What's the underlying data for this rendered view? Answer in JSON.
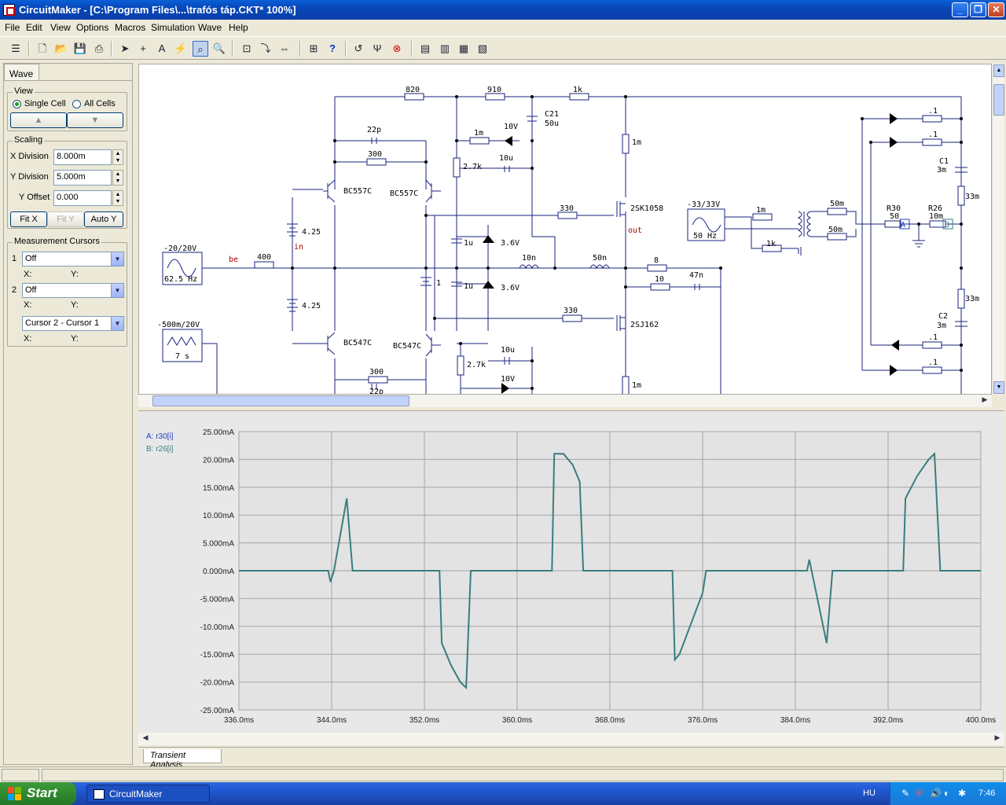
{
  "window": {
    "title": "CircuitMaker - [C:\\Program Files\\...\\trafós táp.CKT* 100%]"
  },
  "menu": [
    "File",
    "Edit",
    "View",
    "Options",
    "Macros",
    "Simulation",
    "Wave",
    "Help"
  ],
  "panel": {
    "tab": "Wave",
    "view_group": "View",
    "single_cell": "Single Cell",
    "all_cells": "All Cells",
    "up_arrow": "▲",
    "down_arrow": "▼",
    "scaling_group": "Scaling",
    "x_division_label": "X Division",
    "x_division_value": "8.000m",
    "y_division_label": "Y Division",
    "y_division_value": "5.000m",
    "y_offset_label": "Y Offset",
    "y_offset_value": "0.000",
    "fit_x": "Fit X",
    "fit_y": "Fit Y",
    "auto_y": "Auto Y",
    "measurement_group": "Measurement Cursors",
    "cursor1_num": "1",
    "cursor1_value": "Off",
    "cursor2_num": "2",
    "cursor2_value": "Off",
    "cursor_diff_value": "Cursor 2 - Cursor 1",
    "x_label": "X:",
    "y_label": "Y:"
  },
  "schematic": {
    "labels": {
      "r820": "820",
      "r910": "910",
      "r1k_top": "1k",
      "c21": "C21",
      "c21v": "50u",
      "c22p": "22p",
      "r300a": "300",
      "r1m_a": "1m",
      "z10v": "10V",
      "r2_7k": "2.7k",
      "c10u": "10u",
      "q_bc557c_1": "BC557C",
      "q_bc557c_2": "BC557C",
      "b425a": "4.25",
      "in": "in",
      "r330a": "330",
      "m2sk": "2SK1058",
      "out": "out",
      "r1m_right": "1m",
      "gen1": "-20/20V",
      "gen1f": "62.5 Hz",
      "be": "be",
      "r400": "400",
      "c1u_a": "1u",
      "z36a": "3.6V",
      "l10n": "10n",
      "l50n": "50n",
      "r8": "8",
      "b1": "1",
      "c1u_b": "1u",
      "z36b": "3.6V",
      "r10": "10",
      "c47n": "47n",
      "b425b": "4.25",
      "r330b": "330",
      "m2sj": "2SJ162",
      "gen2": "-500m/20V",
      "gen2f": "7 s",
      "q_bc547c_1": "BC547C",
      "q_bc547c_2": "BC547C",
      "r2_7k_b": "2.7k",
      "c10u_b": "10u",
      "r300b": "300",
      "c22p_b": "22p",
      "z10v_b": "10V",
      "r1m_bottom": "1m",
      "gen3": "-33/33V",
      "gen3f": "50 Hz",
      "r1m_t": "1m",
      "r50m_a": "50m",
      "r50m_b": "50m",
      "r1k_t": "1k",
      "r30": "R30",
      "r30v": "50",
      "r26": "R26",
      "r26v": "10m",
      "probe_a": "A",
      "probe_b": "B",
      "d01a": ".1",
      "d01b": ".1",
      "d01c": ".1",
      "d01d": ".1",
      "c1": "C1",
      "c1v": "3m",
      "c2": "C2",
      "c2v": "3m",
      "r33m_a": "33m",
      "r33m_b": "33m"
    }
  },
  "chart_data": {
    "type": "line",
    "series": [
      {
        "name": "A: r30[i]",
        "color": "#1f3fbf"
      },
      {
        "name": "B: r26[i]",
        "color": "#3a7d7e"
      }
    ],
    "x_ticks": [
      "336.0ms",
      "344.0ms",
      "352.0ms",
      "360.0ms",
      "368.0ms",
      "376.0ms",
      "384.0ms",
      "392.0ms",
      "400.0ms"
    ],
    "y_ticks": [
      "25.00mA",
      "20.00mA",
      "15.00mA",
      "10.00mA",
      "5.000mA",
      "0.000mA",
      "-5.000mA",
      "-10.00mA",
      "-15.00mA",
      "-20.00mA",
      "-25.00mA"
    ],
    "xlim": [
      336,
      400
    ],
    "ylim": [
      -25,
      25
    ],
    "trace_color": "#3a7d7e",
    "points": [
      [
        336,
        0
      ],
      [
        343.7,
        0
      ],
      [
        343.9,
        -2
      ],
      [
        344.2,
        0
      ],
      [
        345.3,
        13
      ],
      [
        345.8,
        0
      ],
      [
        353.3,
        0
      ],
      [
        353.5,
        -13
      ],
      [
        354.3,
        -17
      ],
      [
        355.1,
        -20
      ],
      [
        355.6,
        -21
      ],
      [
        356.0,
        0
      ],
      [
        363.0,
        0
      ],
      [
        363.2,
        21
      ],
      [
        364.0,
        21
      ],
      [
        364.8,
        19
      ],
      [
        365.4,
        16
      ],
      [
        365.7,
        0
      ],
      [
        373.4,
        0
      ],
      [
        373.6,
        -16
      ],
      [
        374.0,
        -15
      ],
      [
        376.0,
        -4
      ],
      [
        376.3,
        0
      ],
      [
        385.0,
        0
      ],
      [
        385.2,
        2
      ],
      [
        386.7,
        -13
      ],
      [
        387.2,
        0
      ],
      [
        393.3,
        0
      ],
      [
        393.5,
        13
      ],
      [
        394.5,
        17
      ],
      [
        395.5,
        20
      ],
      [
        396.0,
        21
      ],
      [
        396.5,
        0
      ],
      [
        400,
        0
      ]
    ]
  },
  "bottom_tab": "Transient Analysis",
  "taskbar": {
    "start": "Start",
    "task": "CircuitMaker",
    "lang": "HU",
    "time": "7:46"
  }
}
